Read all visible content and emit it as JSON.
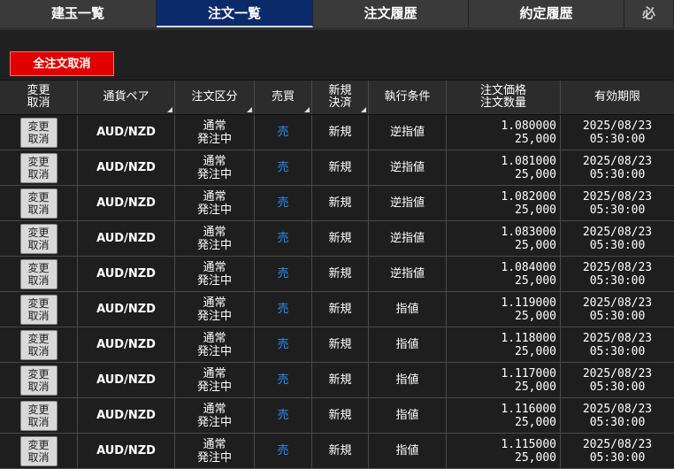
{
  "tabs": [
    {
      "label": "建玉一覧"
    },
    {
      "label": "注文一覧"
    },
    {
      "label": "注文履歴"
    },
    {
      "label": "約定履歴"
    },
    {
      "label": "必"
    }
  ],
  "actions": {
    "cancel_all_label": "全注文取消"
  },
  "columns": {
    "change": [
      "変更",
      "取消"
    ],
    "pair": "通貨ペア",
    "order_type": "注文区分",
    "side": "売買",
    "open_close": [
      "新規",
      "決済"
    ],
    "condition": "執行条件",
    "price_qty": [
      "注文価格",
      "注文数量"
    ],
    "expiry": "有効期限"
  },
  "orders": [
    {
      "btn1": "変更",
      "btn2": "取消",
      "pair": "AUD/NZD",
      "type1": "通常",
      "type2": "発注中",
      "side": "売",
      "open": "新規",
      "condition": "逆指値",
      "price": "1.080000",
      "qty": "25,000",
      "date": "2025/08/23",
      "time": "05:30:00"
    },
    {
      "btn1": "変更",
      "btn2": "取消",
      "pair": "AUD/NZD",
      "type1": "通常",
      "type2": "発注中",
      "side": "売",
      "open": "新規",
      "condition": "逆指値",
      "price": "1.081000",
      "qty": "25,000",
      "date": "2025/08/23",
      "time": "05:30:00"
    },
    {
      "btn1": "変更",
      "btn2": "取消",
      "pair": "AUD/NZD",
      "type1": "通常",
      "type2": "発注中",
      "side": "売",
      "open": "新規",
      "condition": "逆指値",
      "price": "1.082000",
      "qty": "25,000",
      "date": "2025/08/23",
      "time": "05:30:00"
    },
    {
      "btn1": "変更",
      "btn2": "取消",
      "pair": "AUD/NZD",
      "type1": "通常",
      "type2": "発注中",
      "side": "売",
      "open": "新規",
      "condition": "逆指値",
      "price": "1.083000",
      "qty": "25,000",
      "date": "2025/08/23",
      "time": "05:30:00"
    },
    {
      "btn1": "変更",
      "btn2": "取消",
      "pair": "AUD/NZD",
      "type1": "通常",
      "type2": "発注中",
      "side": "売",
      "open": "新規",
      "condition": "逆指値",
      "price": "1.084000",
      "qty": "25,000",
      "date": "2025/08/23",
      "time": "05:30:00"
    },
    {
      "btn1": "変更",
      "btn2": "取消",
      "pair": "AUD/NZD",
      "type1": "通常",
      "type2": "発注中",
      "side": "売",
      "open": "新規",
      "condition": "指値",
      "price": "1.119000",
      "qty": "25,000",
      "date": "2025/08/23",
      "time": "05:30:00"
    },
    {
      "btn1": "変更",
      "btn2": "取消",
      "pair": "AUD/NZD",
      "type1": "通常",
      "type2": "発注中",
      "side": "売",
      "open": "新規",
      "condition": "指値",
      "price": "1.118000",
      "qty": "25,000",
      "date": "2025/08/23",
      "time": "05:30:00"
    },
    {
      "btn1": "変更",
      "btn2": "取消",
      "pair": "AUD/NZD",
      "type1": "通常",
      "type2": "発注中",
      "side": "売",
      "open": "新規",
      "condition": "指値",
      "price": "1.117000",
      "qty": "25,000",
      "date": "2025/08/23",
      "time": "05:30:00"
    },
    {
      "btn1": "変更",
      "btn2": "取消",
      "pair": "AUD/NZD",
      "type1": "通常",
      "type2": "発注中",
      "side": "売",
      "open": "新規",
      "condition": "指値",
      "price": "1.116000",
      "qty": "25,000",
      "date": "2025/08/23",
      "time": "05:30:00"
    },
    {
      "btn1": "変更",
      "btn2": "取消",
      "pair": "AUD/NZD",
      "type1": "通常",
      "type2": "発注中",
      "side": "売",
      "open": "新規",
      "condition": "指値",
      "price": "1.115000",
      "qty": "25,000",
      "date": "2025/08/23",
      "time": "05:30:00"
    }
  ],
  "colors": {
    "accent_tab": "#0a2a6a",
    "cancel_red": "#e00000",
    "sell_blue": "#2c8fff"
  }
}
